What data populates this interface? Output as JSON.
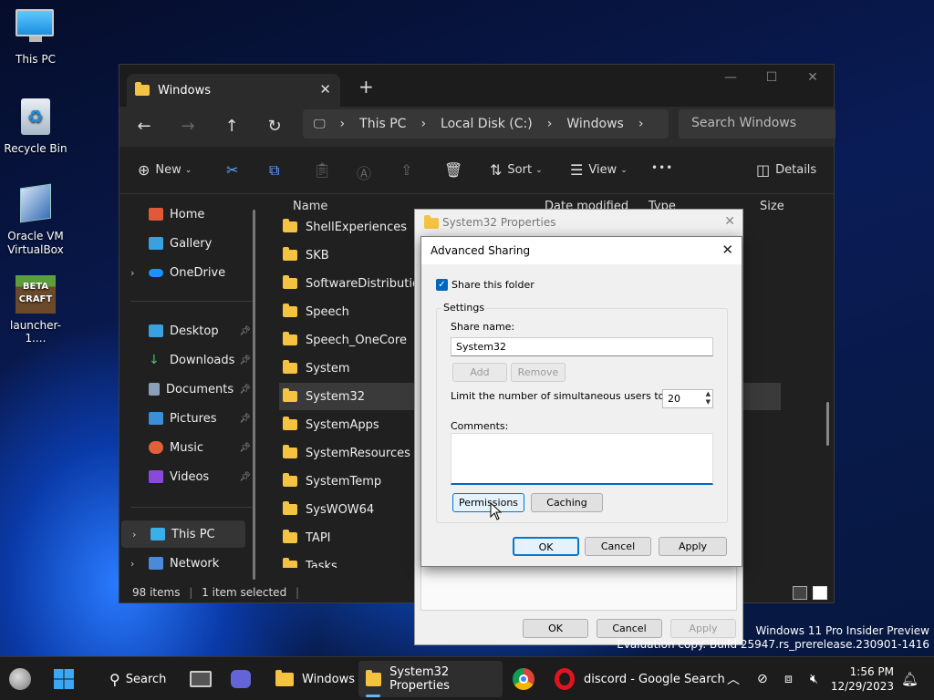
{
  "desktop": {
    "icons": [
      "This PC",
      "Recycle Bin",
      "Oracle VM VirtualBox",
      "launcher-1...."
    ]
  },
  "watermark": {
    "line1": "Windows 11 Pro Insider Preview",
    "line2": "Evaluation copy. Build 25947.rs_prerelease.230901-1416"
  },
  "explorer": {
    "tab_title": "Windows",
    "tab_close": "✕",
    "new_tab": "+",
    "minimize": "—",
    "maximize": "☐",
    "close": "✕",
    "breadcrumb": [
      "This PC",
      "Local Disk (C:)",
      "Windows"
    ],
    "search_placeholder": "Search Windows",
    "cmd": {
      "new": "New",
      "sort": "Sort",
      "view": "View",
      "more": "•••",
      "details": "Details"
    },
    "sidebar": {
      "home": "Home",
      "gallery": "Gallery",
      "onedrive": "OneDrive",
      "desktop": "Desktop",
      "downloads": "Downloads",
      "documents": "Documents",
      "pictures": "Pictures",
      "music": "Music",
      "videos": "Videos",
      "thispc": "This PC",
      "network": "Network"
    },
    "columns": {
      "name": "Name",
      "date": "Date modified",
      "type": "Type",
      "size": "Size"
    },
    "files": [
      "ShellExperiences",
      "SKB",
      "SoftwareDistribution",
      "Speech",
      "Speech_OneCore",
      "System",
      "System32",
      "SystemApps",
      "SystemResources",
      "SystemTemp",
      "SysWOW64",
      "TAPI",
      "Tasks"
    ],
    "selected_index": 6,
    "status": {
      "items": "98 items",
      "selected": "1 item selected"
    }
  },
  "props": {
    "title": "System32 Properties",
    "ok": "OK",
    "cancel": "Cancel",
    "apply": "Apply",
    "close": "✕"
  },
  "adv": {
    "title": "Advanced Sharing",
    "close": "✕",
    "share_checkbox": "Share this folder",
    "share_checked": true,
    "settings": "Settings",
    "share_name_label": "Share name:",
    "share_name": "System32",
    "add": "Add",
    "remove": "Remove",
    "limit_label": "Limit the number of simultaneous users to:",
    "limit_value": "20",
    "comments_label": "Comments:",
    "comments_value": "",
    "permissions": "Permissions",
    "caching": "Caching",
    "ok": "OK",
    "cancel": "Cancel",
    "apply": "Apply"
  },
  "taskbar": {
    "search": "Search",
    "windows": "Windows",
    "props": "System32 Properties",
    "discord": "discord - Google Search",
    "time": "1:56 PM",
    "date": "12/29/2023"
  }
}
